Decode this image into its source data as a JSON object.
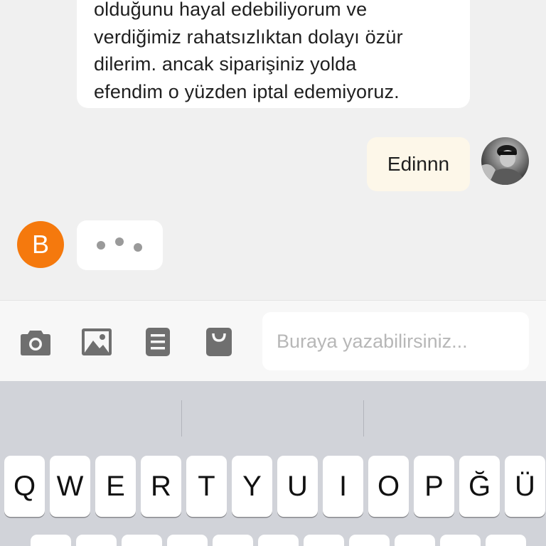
{
  "chat": {
    "agent_message_lines": [
      "olduğunu hayal edebiliyorum ve",
      "verdiğimiz rahatsızlıktan dolayı özür",
      "dilerim. ancak siparişiniz yolda",
      "efendim o yüzden iptal edemiyoruz."
    ],
    "user_message": "Edinnn",
    "agent_avatar_letter": "B"
  },
  "composer": {
    "placeholder": "Buraya yazabilirsiniz...",
    "icons": [
      "camera-icon",
      "image-icon",
      "document-icon",
      "shopping-bag-icon"
    ]
  },
  "keyboard": {
    "row1": [
      "Q",
      "W",
      "E",
      "R",
      "T",
      "Y",
      "U",
      "I",
      "O",
      "P",
      "Ğ",
      "Ü"
    ]
  },
  "colors": {
    "chat_background": "#f0f0f0",
    "agent_avatar": "#f5790d",
    "user_bubble": "#fdf7e9",
    "keyboard_background": "#d1d3d9",
    "placeholder_text": "#b7b7b7"
  }
}
